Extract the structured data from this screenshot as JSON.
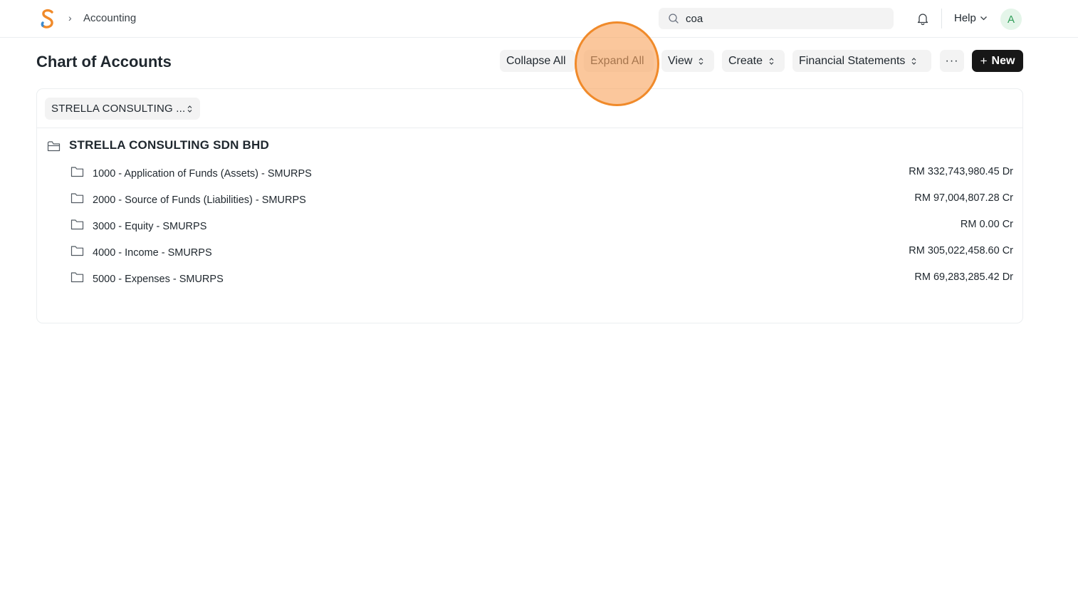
{
  "navbar": {
    "breadcrumb": "Accounting",
    "breadcrumb_separator": "›",
    "search_value": "coa",
    "help_label": "Help",
    "avatar_initial": "A"
  },
  "header": {
    "title": "Chart of Accounts",
    "buttons": {
      "collapse_all": "Collapse All",
      "expand_all": "Expand All",
      "view": "View",
      "create": "Create",
      "financial_statements": "Financial Statements",
      "more": "···",
      "new_plus": "+",
      "new": "New"
    }
  },
  "tree": {
    "company_filter": "STRELLA CONSULTING ...",
    "root": "STRELLA CONSULTING SDN BHD",
    "accounts": [
      {
        "name": "1000 - Application of Funds (Assets) - SMURPS",
        "balance": "RM 332,743,980.45 Dr"
      },
      {
        "name": "2000 - Source of Funds (Liabilities) - SMURPS",
        "balance": "RM 97,004,807.28 Cr"
      },
      {
        "name": "3000 - Equity - SMURPS",
        "balance": "RM 0.00 Cr"
      },
      {
        "name": "4000 - Income - SMURPS",
        "balance": "RM 305,022,458.60 Cr"
      },
      {
        "name": "5000 - Expenses - SMURPS",
        "balance": "RM 69,283,285.42 Dr"
      }
    ]
  },
  "colors": {
    "highlight": "#f08a2a",
    "primary_button": "#171717",
    "avatar_bg": "#e4f5e9",
    "avatar_text": "#2f9d58",
    "logo_orange": "#f08a2a",
    "logo_blue": "#3b8bd0"
  }
}
